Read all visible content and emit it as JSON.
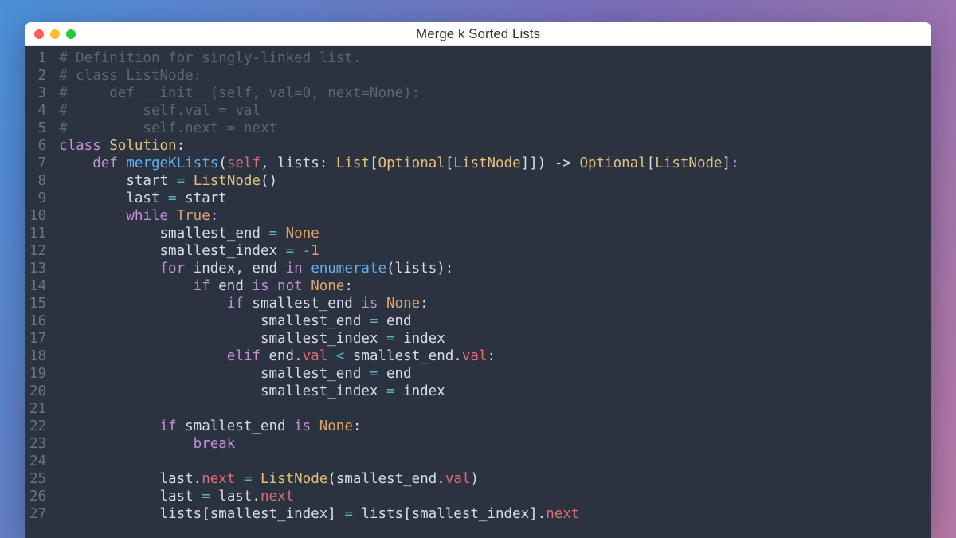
{
  "window": {
    "title": "Merge k Sorted Lists"
  },
  "code": {
    "lines": [
      [
        {
          "c": "tok-comment",
          "t": "# Definition for singly-linked list."
        }
      ],
      [
        {
          "c": "tok-comment",
          "t": "# class ListNode:"
        }
      ],
      [
        {
          "c": "tok-comment",
          "t": "#     def __init__(self, val=0, next=None):"
        }
      ],
      [
        {
          "c": "tok-comment",
          "t": "#         self.val = val"
        }
      ],
      [
        {
          "c": "tok-comment",
          "t": "#         self.next = next"
        }
      ],
      [
        {
          "c": "tok-kw",
          "t": "class"
        },
        {
          "c": "tok-plain",
          "t": " "
        },
        {
          "c": "tok-type",
          "t": "Solution"
        },
        {
          "c": "tok-plain",
          "t": ":"
        }
      ],
      [
        {
          "c": "tok-plain",
          "t": "    "
        },
        {
          "c": "tok-kw",
          "t": "def"
        },
        {
          "c": "tok-plain",
          "t": " "
        },
        {
          "c": "tok-func",
          "t": "mergeKLists"
        },
        {
          "c": "tok-plain",
          "t": "("
        },
        {
          "c": "tok-self",
          "t": "self"
        },
        {
          "c": "tok-plain",
          "t": ", lists: "
        },
        {
          "c": "tok-type",
          "t": "List"
        },
        {
          "c": "tok-plain",
          "t": "["
        },
        {
          "c": "tok-type",
          "t": "Optional"
        },
        {
          "c": "tok-plain",
          "t": "["
        },
        {
          "c": "tok-type",
          "t": "ListNode"
        },
        {
          "c": "tok-plain",
          "t": "]]) -> "
        },
        {
          "c": "tok-type",
          "t": "Optional"
        },
        {
          "c": "tok-plain",
          "t": "["
        },
        {
          "c": "tok-type",
          "t": "ListNode"
        },
        {
          "c": "tok-plain",
          "t": "]:"
        }
      ],
      [
        {
          "c": "tok-plain",
          "t": "        start "
        },
        {
          "c": "tok-op",
          "t": "="
        },
        {
          "c": "tok-plain",
          "t": " "
        },
        {
          "c": "tok-type",
          "t": "ListNode"
        },
        {
          "c": "tok-plain",
          "t": "()"
        }
      ],
      [
        {
          "c": "tok-plain",
          "t": "        last "
        },
        {
          "c": "tok-op",
          "t": "="
        },
        {
          "c": "tok-plain",
          "t": " start"
        }
      ],
      [
        {
          "c": "tok-plain",
          "t": "        "
        },
        {
          "c": "tok-kw",
          "t": "while"
        },
        {
          "c": "tok-plain",
          "t": " "
        },
        {
          "c": "tok-const",
          "t": "True"
        },
        {
          "c": "tok-plain",
          "t": ":"
        }
      ],
      [
        {
          "c": "tok-plain",
          "t": "            smallest_end "
        },
        {
          "c": "tok-op",
          "t": "="
        },
        {
          "c": "tok-plain",
          "t": " "
        },
        {
          "c": "tok-const",
          "t": "None"
        }
      ],
      [
        {
          "c": "tok-plain",
          "t": "            smallest_index "
        },
        {
          "c": "tok-op",
          "t": "="
        },
        {
          "c": "tok-plain",
          "t": " "
        },
        {
          "c": "tok-op",
          "t": "-"
        },
        {
          "c": "tok-const",
          "t": "1"
        }
      ],
      [
        {
          "c": "tok-plain",
          "t": "            "
        },
        {
          "c": "tok-kw",
          "t": "for"
        },
        {
          "c": "tok-plain",
          "t": " index, end "
        },
        {
          "c": "tok-kw",
          "t": "in"
        },
        {
          "c": "tok-plain",
          "t": " "
        },
        {
          "c": "tok-func",
          "t": "enumerate"
        },
        {
          "c": "tok-plain",
          "t": "(lists):"
        }
      ],
      [
        {
          "c": "tok-plain",
          "t": "                "
        },
        {
          "c": "tok-kw",
          "t": "if"
        },
        {
          "c": "tok-plain",
          "t": " end "
        },
        {
          "c": "tok-kw",
          "t": "is"
        },
        {
          "c": "tok-plain",
          "t": " "
        },
        {
          "c": "tok-kw",
          "t": "not"
        },
        {
          "c": "tok-plain",
          "t": " "
        },
        {
          "c": "tok-const",
          "t": "None"
        },
        {
          "c": "tok-plain",
          "t": ":"
        }
      ],
      [
        {
          "c": "tok-plain",
          "t": "                    "
        },
        {
          "c": "tok-kw",
          "t": "if"
        },
        {
          "c": "tok-plain",
          "t": " smallest_end "
        },
        {
          "c": "tok-kw",
          "t": "is"
        },
        {
          "c": "tok-plain",
          "t": " "
        },
        {
          "c": "tok-const",
          "t": "None"
        },
        {
          "c": "tok-plain",
          "t": ":"
        }
      ],
      [
        {
          "c": "tok-plain",
          "t": "                        smallest_end "
        },
        {
          "c": "tok-op",
          "t": "="
        },
        {
          "c": "tok-plain",
          "t": " end"
        }
      ],
      [
        {
          "c": "tok-plain",
          "t": "                        smallest_index "
        },
        {
          "c": "tok-op",
          "t": "="
        },
        {
          "c": "tok-plain",
          "t": " index"
        }
      ],
      [
        {
          "c": "tok-plain",
          "t": "                    "
        },
        {
          "c": "tok-kw",
          "t": "elif"
        },
        {
          "c": "tok-plain",
          "t": " end."
        },
        {
          "c": "tok-self",
          "t": "val"
        },
        {
          "c": "tok-plain",
          "t": " "
        },
        {
          "c": "tok-op",
          "t": "<"
        },
        {
          "c": "tok-plain",
          "t": " smallest_end."
        },
        {
          "c": "tok-self",
          "t": "val"
        },
        {
          "c": "tok-plain",
          "t": ":"
        }
      ],
      [
        {
          "c": "tok-plain",
          "t": "                        smallest_end "
        },
        {
          "c": "tok-op",
          "t": "="
        },
        {
          "c": "tok-plain",
          "t": " end"
        }
      ],
      [
        {
          "c": "tok-plain",
          "t": "                        smallest_index "
        },
        {
          "c": "tok-op",
          "t": "="
        },
        {
          "c": "tok-plain",
          "t": " index"
        }
      ],
      [
        {
          "c": "tok-plain",
          "t": ""
        }
      ],
      [
        {
          "c": "tok-plain",
          "t": "            "
        },
        {
          "c": "tok-kw",
          "t": "if"
        },
        {
          "c": "tok-plain",
          "t": " smallest_end "
        },
        {
          "c": "tok-kw",
          "t": "is"
        },
        {
          "c": "tok-plain",
          "t": " "
        },
        {
          "c": "tok-const",
          "t": "None"
        },
        {
          "c": "tok-plain",
          "t": ":"
        }
      ],
      [
        {
          "c": "tok-plain",
          "t": "                "
        },
        {
          "c": "tok-kw",
          "t": "break"
        }
      ],
      [
        {
          "c": "tok-plain",
          "t": ""
        }
      ],
      [
        {
          "c": "tok-plain",
          "t": "            last."
        },
        {
          "c": "tok-self",
          "t": "next"
        },
        {
          "c": "tok-plain",
          "t": " "
        },
        {
          "c": "tok-op",
          "t": "="
        },
        {
          "c": "tok-plain",
          "t": " "
        },
        {
          "c": "tok-type",
          "t": "ListNode"
        },
        {
          "c": "tok-plain",
          "t": "(smallest_end."
        },
        {
          "c": "tok-self",
          "t": "val"
        },
        {
          "c": "tok-plain",
          "t": ")"
        }
      ],
      [
        {
          "c": "tok-plain",
          "t": "            last "
        },
        {
          "c": "tok-op",
          "t": "="
        },
        {
          "c": "tok-plain",
          "t": " last."
        },
        {
          "c": "tok-self",
          "t": "next"
        }
      ],
      [
        {
          "c": "tok-plain",
          "t": "            lists[smallest_index] "
        },
        {
          "c": "tok-op",
          "t": "="
        },
        {
          "c": "tok-plain",
          "t": " lists[smallest_index]."
        },
        {
          "c": "tok-self",
          "t": "next"
        }
      ]
    ]
  }
}
